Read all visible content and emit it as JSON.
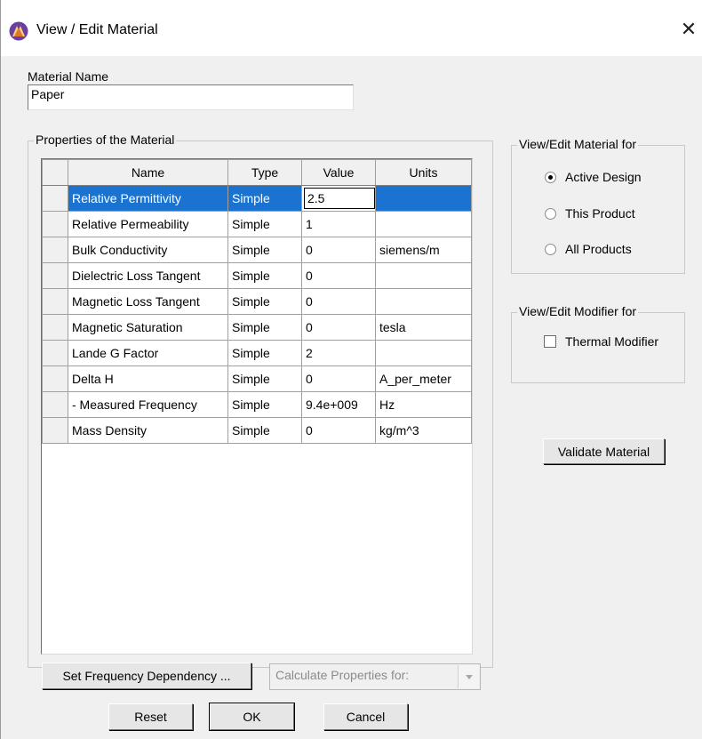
{
  "window": {
    "title": "View / Edit Material",
    "close_glyph": "✕",
    "app_icon": "ansys-logo-icon"
  },
  "material_name": {
    "label": "Material Name",
    "value": "Paper"
  },
  "properties": {
    "group_label": "Properties of the Material",
    "columns": [
      "Name",
      "Type",
      "Value",
      "Units"
    ],
    "rows": [
      {
        "name": "Relative Permittivity",
        "type": "Simple",
        "value": "2.5",
        "units": "",
        "selected": true
      },
      {
        "name": "Relative Permeability",
        "type": "Simple",
        "value": "1",
        "units": ""
      },
      {
        "name": "Bulk Conductivity",
        "type": "Simple",
        "value": "0",
        "units": "siemens/m"
      },
      {
        "name": "Dielectric Loss Tangent",
        "type": "Simple",
        "value": "0",
        "units": ""
      },
      {
        "name": "Magnetic Loss Tangent",
        "type": "Simple",
        "value": "0",
        "units": ""
      },
      {
        "name": "Magnetic Saturation",
        "type": "Simple",
        "value": "0",
        "units": "tesla"
      },
      {
        "name": "Lande G Factor",
        "type": "Simple",
        "value": "2",
        "units": ""
      },
      {
        "name": "Delta H",
        "type": "Simple",
        "value": "0",
        "units": "A_per_meter"
      },
      {
        "name": "- Measured Frequency",
        "type": "Simple",
        "value": "9.4e+009",
        "units": "Hz"
      },
      {
        "name": "Mass Density",
        "type": "Simple",
        "value": "0",
        "units": "kg/m^3"
      }
    ]
  },
  "view_edit_for": {
    "group_label": "View/Edit Material for",
    "options": [
      "Active Design",
      "This Product",
      "All Products"
    ],
    "selected": "Active Design"
  },
  "modifier_for": {
    "group_label": "View/Edit Modifier for",
    "thermal_label": "Thermal Modifier",
    "thermal_checked": false
  },
  "buttons": {
    "validate": "Validate Material",
    "set_freq": "Set Frequency Dependency ...",
    "reset": "Reset",
    "ok": "OK",
    "cancel": "Cancel"
  },
  "calc_props": {
    "placeholder": "Calculate Properties for:"
  },
  "colors": {
    "selection": "#1a73d1",
    "dialog_bg": "#f0f0f0"
  }
}
